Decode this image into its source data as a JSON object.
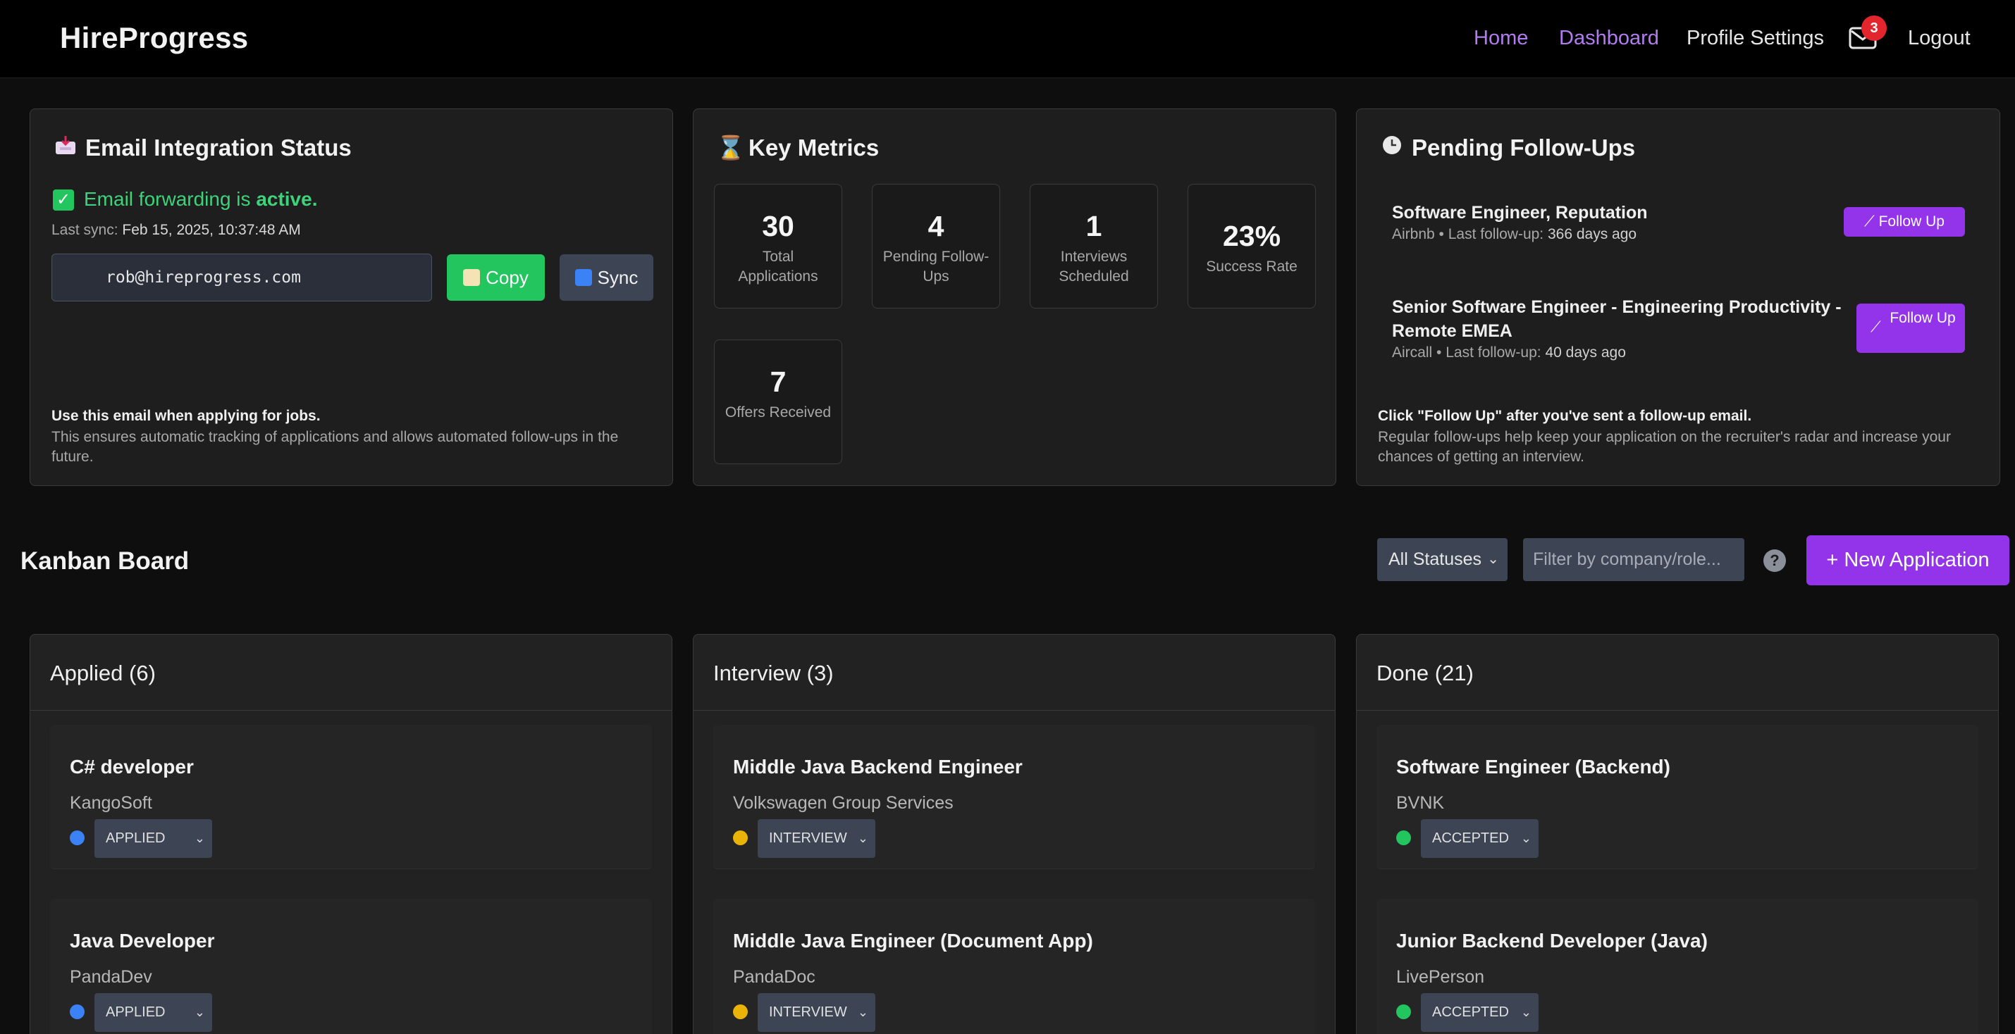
{
  "nav": {
    "brand": "HireProgress",
    "links": [
      "Home",
      "Dashboard",
      "Profile Settings",
      "Logout"
    ],
    "mail_badge": "3",
    "active_color": "#b07cf0"
  },
  "email_card": {
    "icon": "inbox-tray-icon",
    "title": "Email Integration Status",
    "status_prefix": "Email forwarding is",
    "status_value": "active.",
    "last_sync_label": "Last sync:",
    "last_sync_value": "Feb 15, 2025, 10:37:48 AM",
    "address": "rob@hireprogress.com",
    "copy_label": "Copy",
    "sync_label": "Sync",
    "note_bold": "Use this email when applying for jobs.",
    "note_text": "This ensures automatic tracking of applications and allows automated follow-ups in the future."
  },
  "metrics_card": {
    "icon": "hourglass-icon",
    "title": "Key Metrics",
    "items": [
      {
        "value": "30",
        "label": "Total Applications"
      },
      {
        "value": "4",
        "label": "Pending Follow-Ups"
      },
      {
        "value": "1",
        "label": "Interviews Scheduled"
      },
      {
        "value": "23%",
        "label": "Success Rate"
      },
      {
        "value": "7",
        "label": "Offers Received"
      }
    ]
  },
  "followups_card": {
    "icon": "clock-icon",
    "title": "Pending Follow-Ups",
    "items": [
      {
        "title": "Software Engineer, Reputation",
        "company": "Airbnb",
        "last_label": "• Last follow-up:",
        "last_value": "366 days ago",
        "button": "Follow Up"
      },
      {
        "title": "Senior Software Engineer - Engineering Productivity - Remote EMEA",
        "company": "Aircall",
        "last_label": "• Last follow-up:",
        "last_value": "40 days ago",
        "button": "Follow Up"
      }
    ],
    "note_bold": "Click \"Follow Up\" after you've sent a follow-up email.",
    "note_text": "Regular follow-ups help keep your application on the recruiter's radar and increase your chances of getting an interview."
  },
  "kanban": {
    "title": "Kanban Board",
    "status_filter": "All Statuses",
    "search_placeholder": "Filter by company/role...",
    "help": "?",
    "new_button": "+ New Application",
    "columns": [
      {
        "title": "Applied (6)",
        "cards": [
          {
            "title": "C# developer",
            "company": "KangoSoft",
            "status": "APPLIED",
            "dot": "#3b82f6"
          },
          {
            "title": "Java Developer",
            "company": "PandaDev",
            "status": "APPLIED",
            "dot": "#3b82f6"
          }
        ]
      },
      {
        "title": "Interview (3)",
        "cards": [
          {
            "title": "Middle Java Backend Engineer",
            "company": "Volkswagen Group Services",
            "status": "INTERVIEW",
            "dot": "#eab308"
          },
          {
            "title": "Middle Java Engineer (Document App)",
            "company": "PandaDoc",
            "status": "INTERVIEW",
            "dot": "#eab308"
          }
        ]
      },
      {
        "title": "Done (21)",
        "cards": [
          {
            "title": "Software Engineer (Backend)",
            "company": "BVNK",
            "status": "ACCEPTED",
            "dot": "#22c55e"
          },
          {
            "title": "Junior Backend Developer (Java)",
            "company": "LivePerson",
            "status": "ACCEPTED",
            "dot": "#22c55e"
          }
        ]
      }
    ]
  }
}
